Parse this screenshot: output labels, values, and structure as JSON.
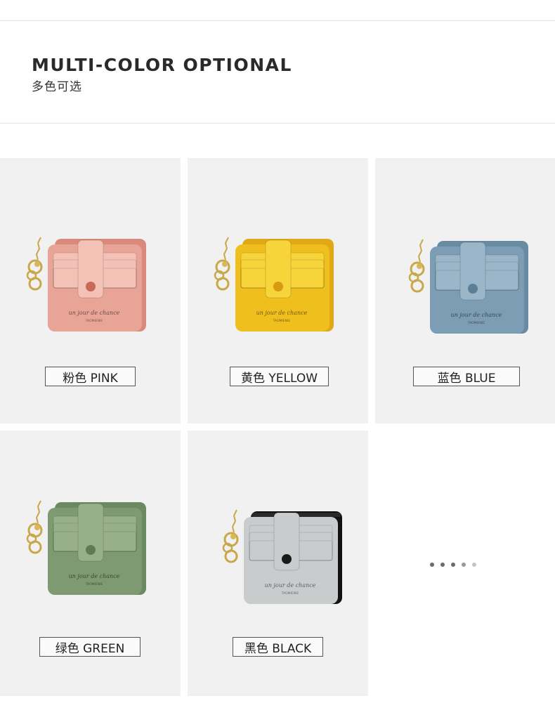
{
  "header": {
    "title_en": "MULTI-COLOR OPTIONAL",
    "title_cn": "多色可选"
  },
  "products": [
    {
      "label": "粉色 PINK",
      "color_name": "pink",
      "body": "#e8a597",
      "front": "#f3c1b6",
      "back": "#d98a7c",
      "button": "#c86a5a"
    },
    {
      "label": "黄色 YELLOW",
      "color_name": "yellow",
      "body": "#efbf1e",
      "front": "#f7d43a",
      "back": "#e0a915",
      "button": "#d89a10"
    },
    {
      "label": "蓝色 BLUE",
      "color_name": "blue",
      "body": "#7c9db3",
      "front": "#9ab6c8",
      "back": "#688aa2",
      "button": "#5b7f96"
    },
    {
      "label": "绿色 GREEN",
      "color_name": "green",
      "body": "#7e9a72",
      "front": "#98b08a",
      "back": "#6c8a61",
      "button": "#5f7d55"
    },
    {
      "label": "黑色 BLACK",
      "color_name": "black",
      "body": "#1e1e1e",
      "front": "#c9cccd",
      "back": "#111111",
      "button": "#1a1a1a"
    }
  ],
  "wallet_script_text": "un jour de chance",
  "wallet_brand_text": "TAOMIENIE",
  "gallery_dots": 5
}
